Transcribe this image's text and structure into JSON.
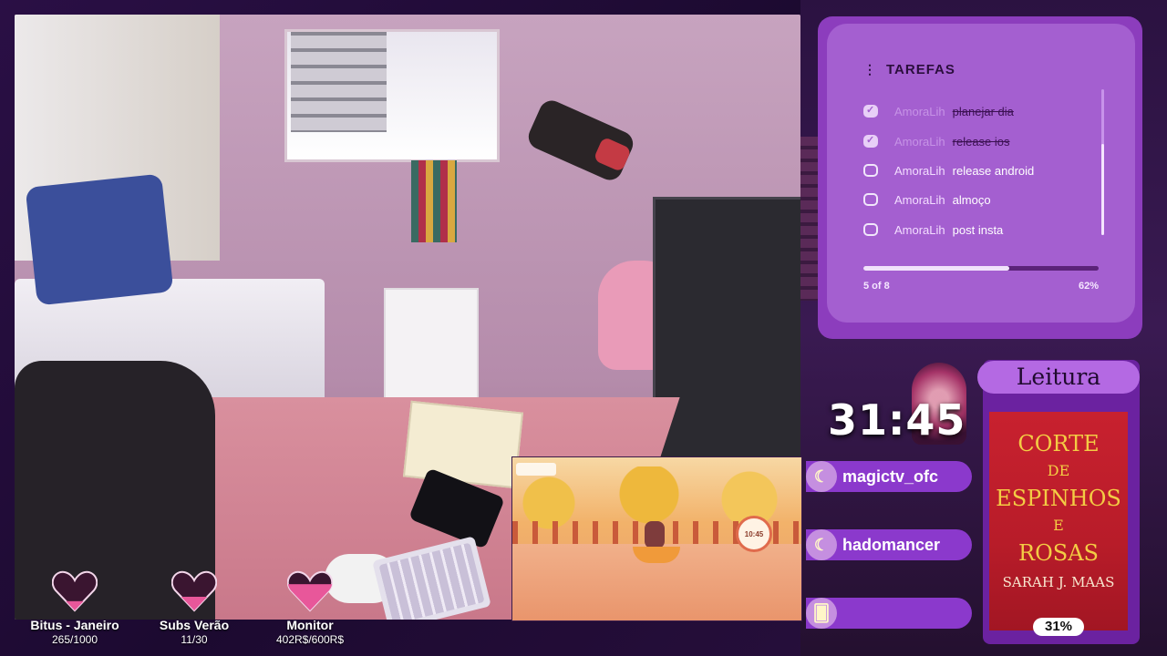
{
  "tasks": {
    "title": "TAREFAS",
    "items": [
      {
        "user": "AmoraLih",
        "text": "planejar dia",
        "done": true
      },
      {
        "user": "AmoraLih",
        "text": "release ios",
        "done": true
      },
      {
        "user": "AmoraLih",
        "text": "release android",
        "done": false
      },
      {
        "user": "AmoraLih",
        "text": "almoço",
        "done": false
      },
      {
        "user": "AmoraLih",
        "text": "post insta",
        "done": false
      }
    ],
    "progress_text": "5 of 8",
    "progress_percent_text": "62%",
    "progress_value": 0.62
  },
  "timer": {
    "value": "31:45"
  },
  "alerts": [
    {
      "name": "magictv_ofc",
      "icon": "moon-icon"
    },
    {
      "name": "hadomancer",
      "icon": "moon-icon"
    },
    {
      "name": "",
      "icon": "cards-icon"
    }
  ],
  "reading": {
    "label": "Leitura",
    "book_title_line1": "CORTE",
    "book_title_line2": "DE",
    "book_title_line3": "ESPINHOS",
    "book_title_line4": "E",
    "book_title_line5": "ROSAS",
    "author": "SARAH J. MAAS",
    "progress": "31%"
  },
  "goals": [
    {
      "title": "Bitus - Janeiro",
      "value": "265/1000",
      "fill": 0.265
    },
    {
      "title": "Subs Verão",
      "value": "11/30",
      "fill": 0.37
    },
    {
      "title": "Monitor",
      "value": "402R$/600R$",
      "fill": 0.67
    }
  ],
  "game": {
    "clock": "10:45"
  },
  "colors": {
    "accent": "#a45fd0",
    "panel_dark": "#8c3dbd",
    "heart": "#e8579a",
    "book": "#c8212f"
  }
}
